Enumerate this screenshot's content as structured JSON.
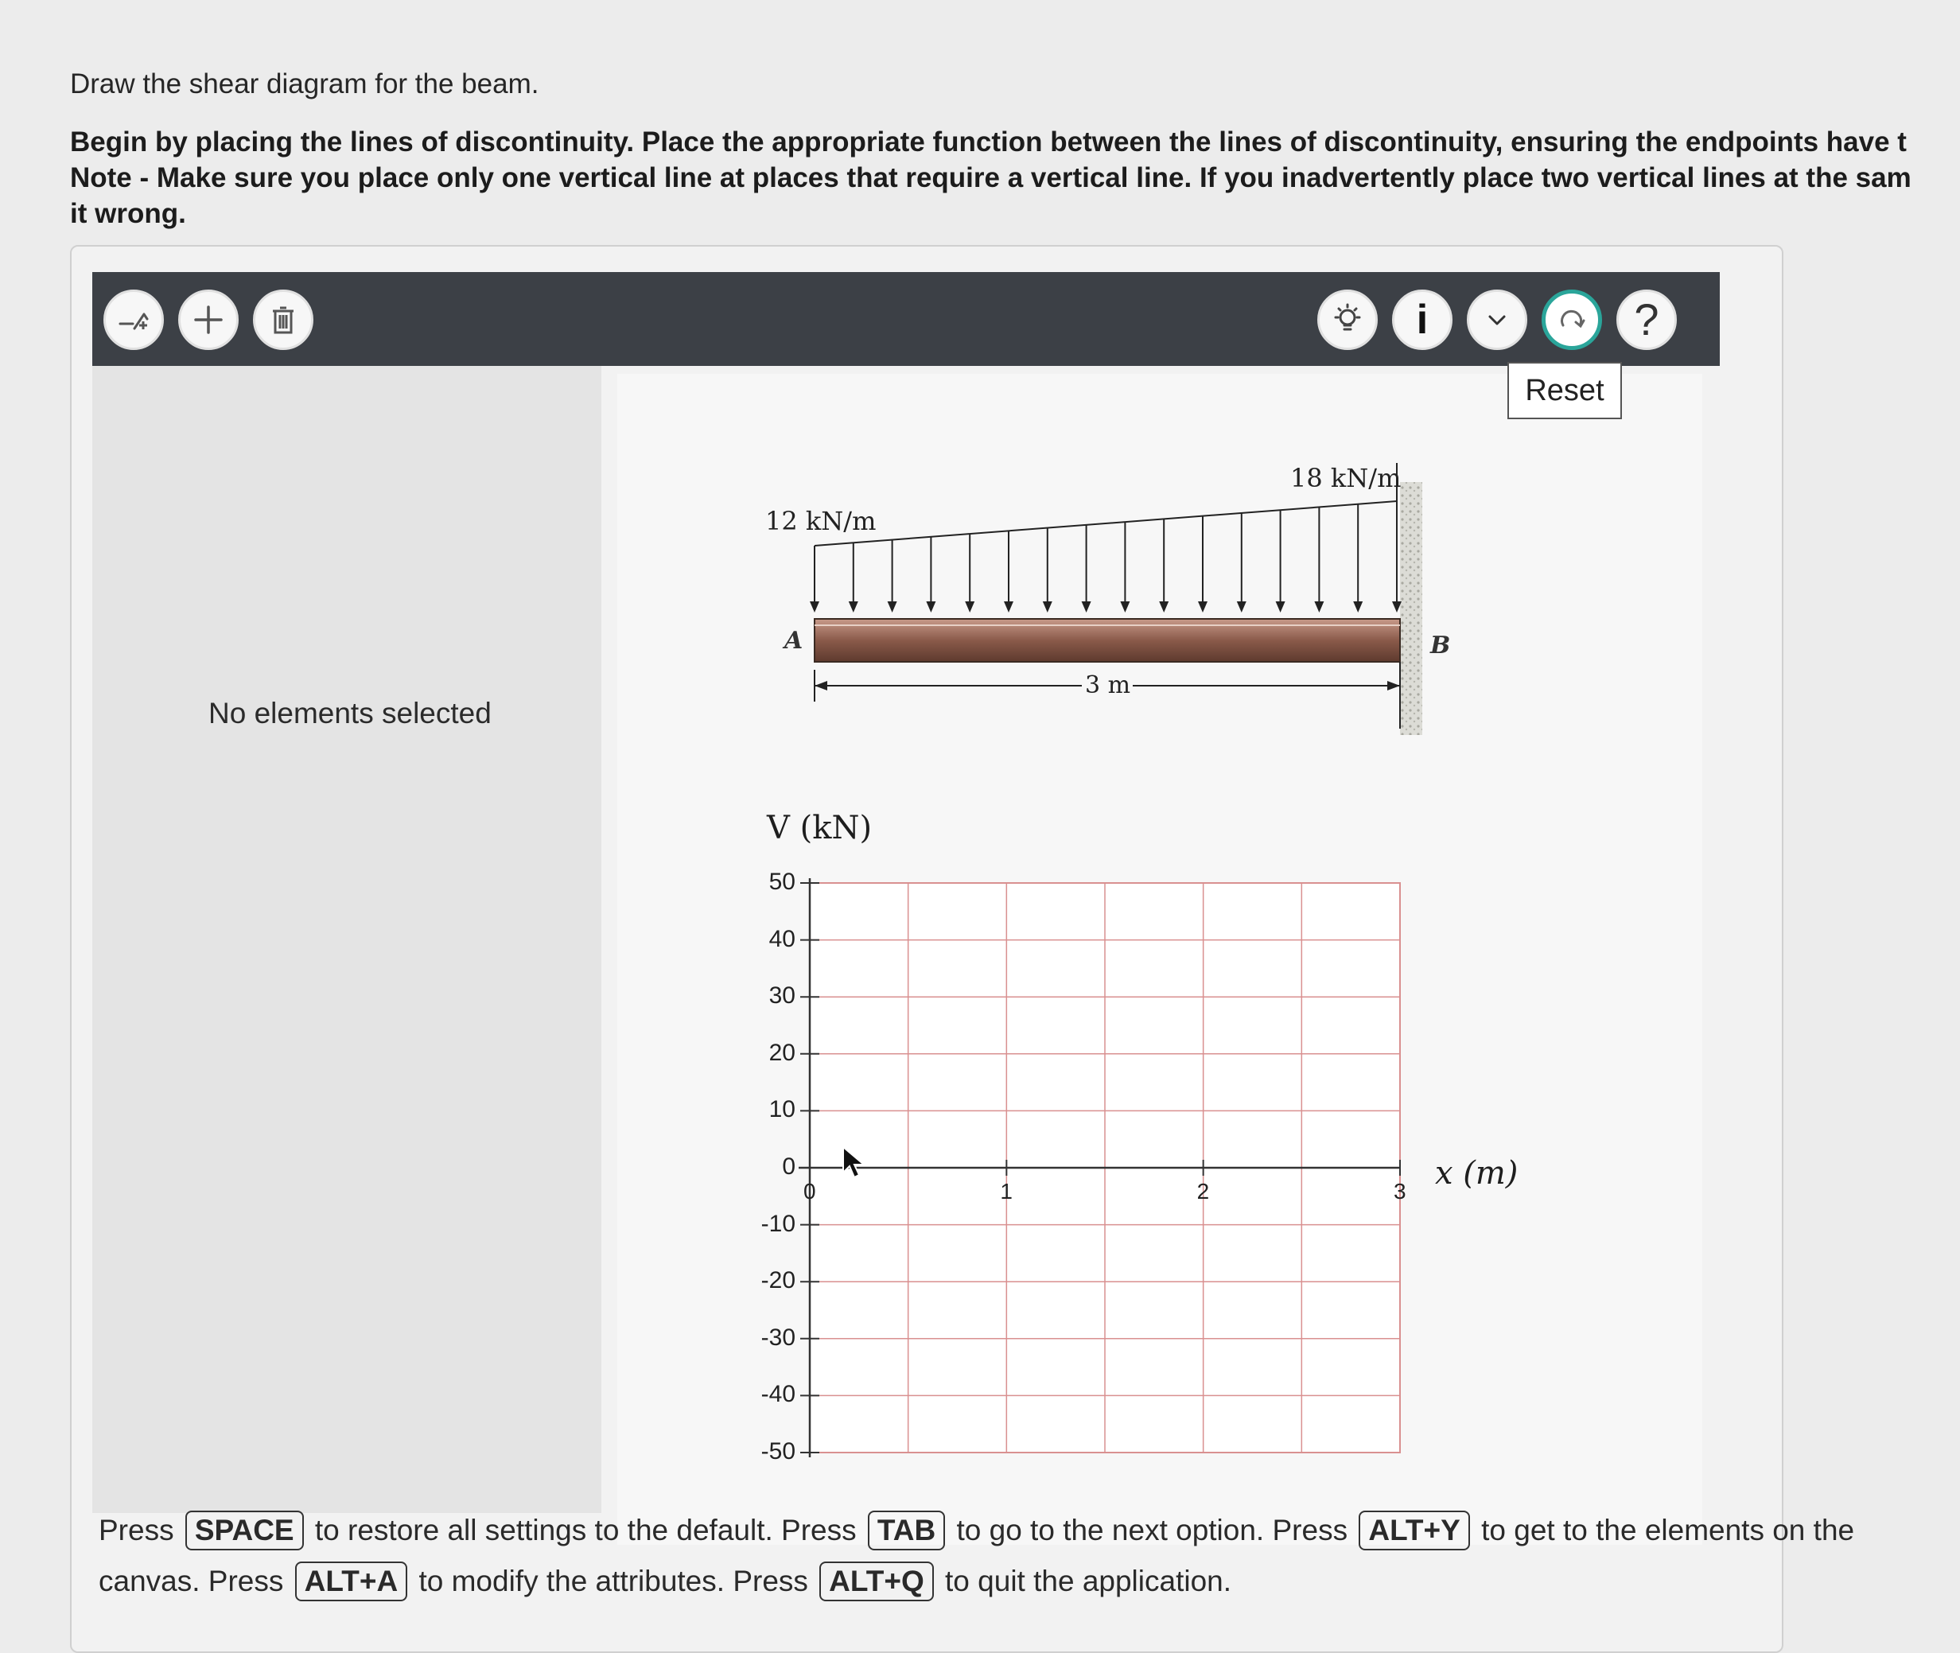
{
  "prompt": {
    "lead": "Draw the shear diagram for the beam.",
    "line1": "Begin by placing the lines of discontinuity. Place the appropriate function between the lines of discontinuity, ensuring the endpoints have t",
    "line2": "Note - Make sure you place only one vertical line at places that require a vertical line. If you inadvertently place two vertical lines at the sam",
    "line3": "it wrong."
  },
  "toolbar": {
    "left_tools": [
      "line-tool-icon",
      "plus-icon",
      "trash-icon"
    ],
    "right_tools": [
      "lightbulb-icon",
      "info-icon",
      "chevron-down-icon",
      "redo-icon",
      "help-icon"
    ],
    "info_glyph": "i",
    "help_glyph": "?",
    "reset_label": "Reset"
  },
  "attributes": {
    "status": "No elements selected"
  },
  "beam": {
    "load_left": "12 kN/m",
    "load_right": "18 kN/m",
    "point_a": "A",
    "point_b": "B",
    "span": "3 m"
  },
  "chart_data": {
    "type": "line",
    "ylabel": "V (kN)",
    "xlabel": "x (m)",
    "xlim": [
      0,
      3
    ],
    "ylim": [
      -50,
      50
    ],
    "x_ticks": [
      "0",
      "1",
      "2",
      "3"
    ],
    "y_ticks": [
      "50",
      "40",
      "30",
      "20",
      "10",
      "0",
      "-10",
      "-20",
      "-30",
      "-40",
      "-50"
    ],
    "grid": true,
    "series": []
  },
  "footer": {
    "t1": "Press",
    "k1": "SPACE",
    "t2": "to restore all settings to the default. Press",
    "k2": "TAB",
    "t3": "to go to the next option. Press",
    "k3": "ALT+Y",
    "t4": "to get to the elements on the canvas. Press",
    "k4": "ALT+A",
    "t5": "to modify the attributes. Press",
    "k5": "ALT+Q",
    "t6": "to quit the application."
  },
  "colors": {
    "toolbar": "#3c4046",
    "grid_line": "#d99090",
    "beam": "#8a5a4a",
    "accent_ring": "#2aa59a"
  }
}
